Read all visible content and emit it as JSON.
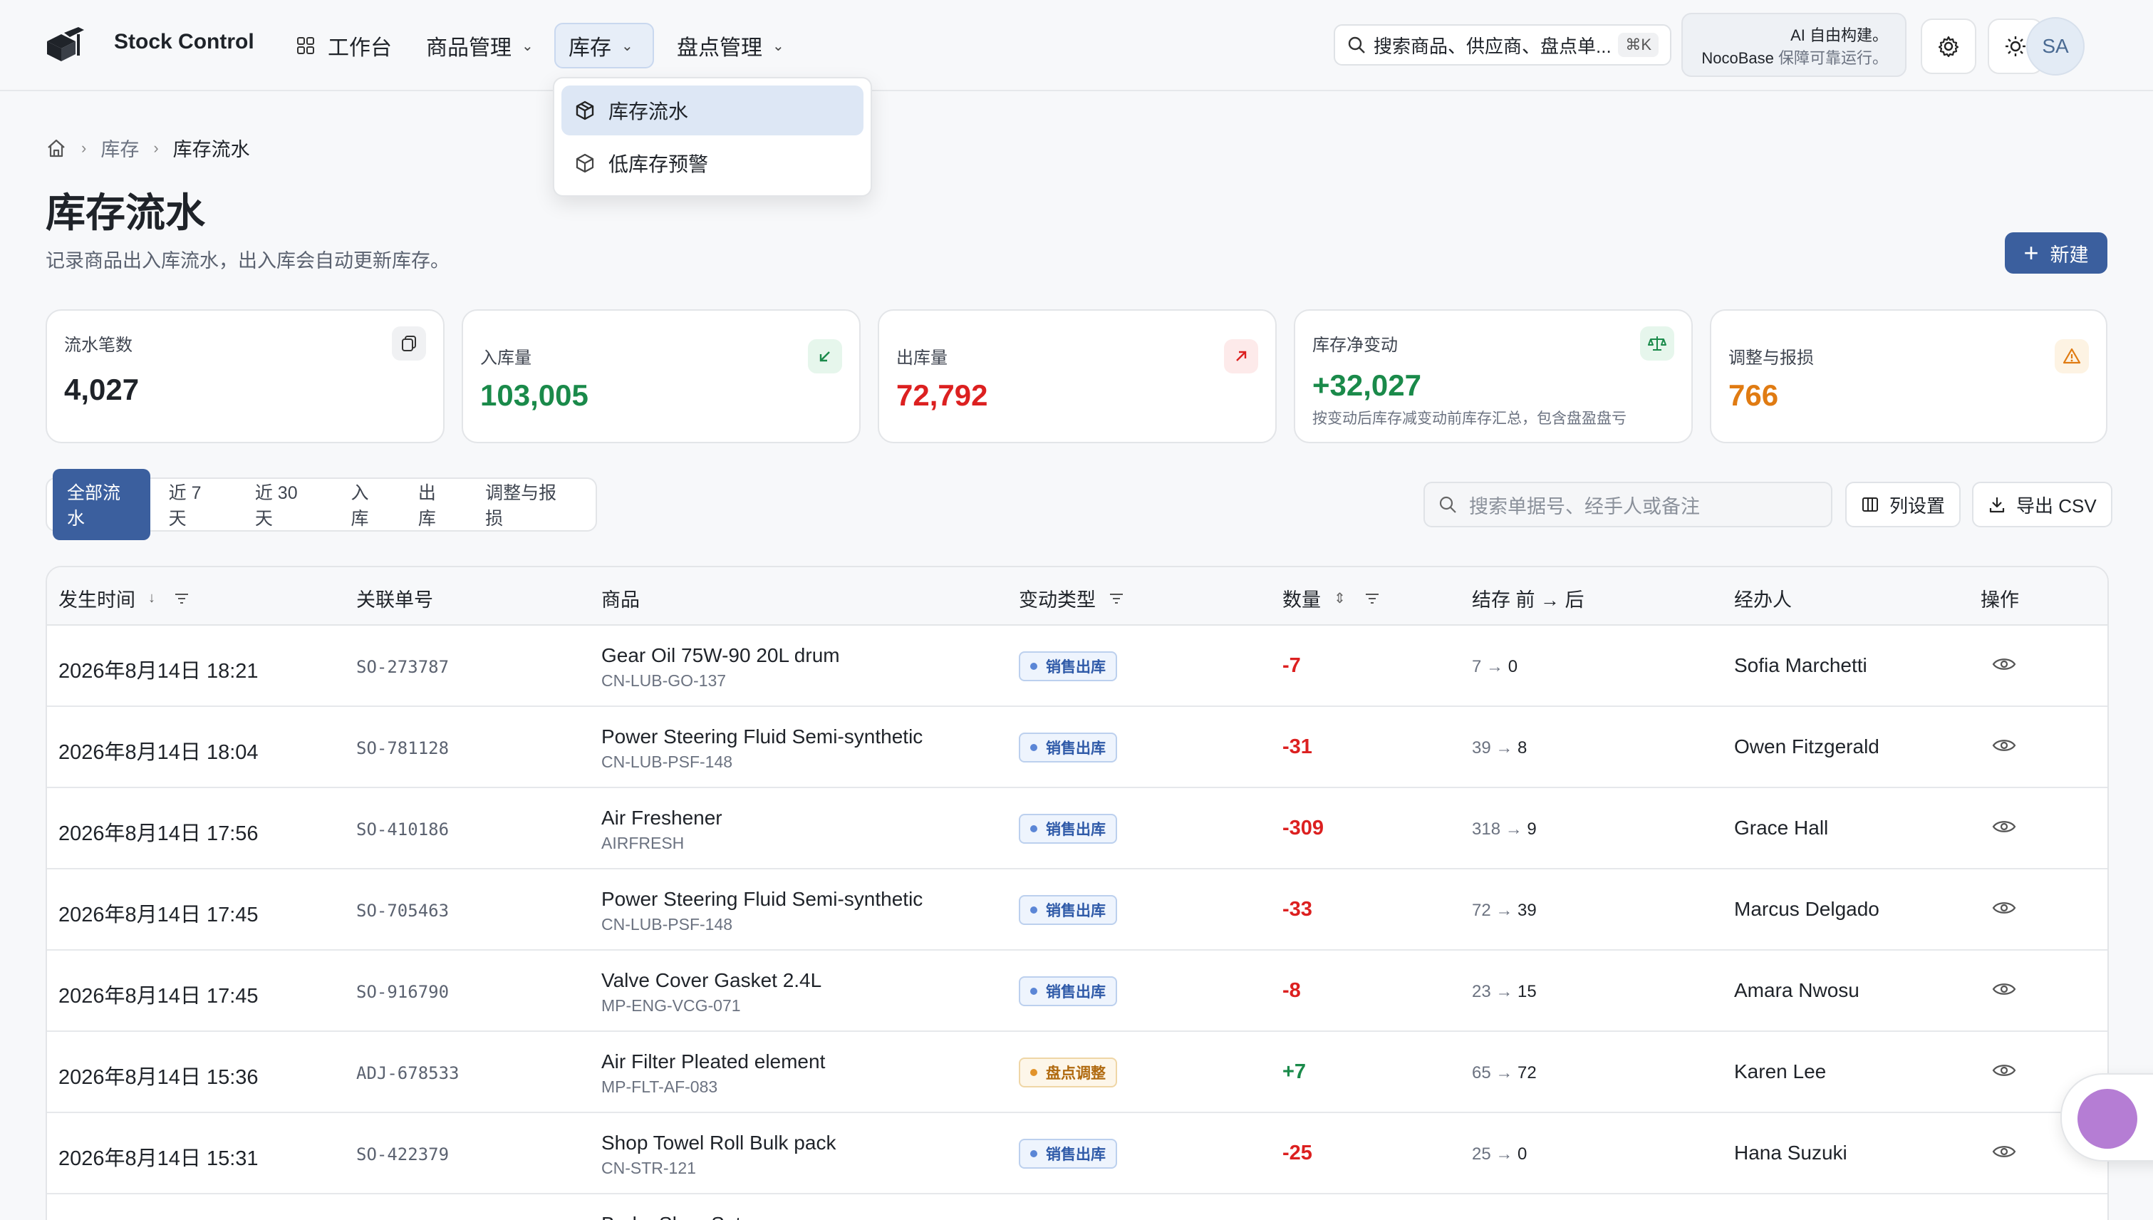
{
  "app": {
    "brand": "Stock Control"
  },
  "nav": {
    "items": [
      {
        "label": "工作台"
      },
      {
        "label": "商品管理"
      },
      {
        "label": "库存"
      },
      {
        "label": "盘点管理"
      }
    ]
  },
  "topbar": {
    "search_placeholder": "搜索商品、供应商、盘点单...",
    "search_shortcut": "⌘K",
    "ai_line1": "AI 自由构建。",
    "ai_brand": "NocoBase",
    "ai_line2": "保障可靠运行。",
    "avatar_initials": "SA"
  },
  "dropdown": {
    "items": [
      {
        "label": "库存流水",
        "icon": "box-icon",
        "selected": true
      },
      {
        "label": "低库存预警",
        "icon": "box-outline-icon",
        "selected": false
      }
    ]
  },
  "breadcrumb": {
    "parent": "库存",
    "current": "库存流水"
  },
  "page": {
    "title": "库存流水",
    "description": "记录商品出入库流水，出入库会自动更新库存。",
    "new_button": "新建"
  },
  "stats": [
    {
      "label": "流水笔数",
      "value": "4,027",
      "color": "#1f2329",
      "icon": "copy-icon"
    },
    {
      "label": "入库量",
      "value": "103,005",
      "color": "#1a8a4a",
      "icon": "arrow-down-left-icon"
    },
    {
      "label": "出库量",
      "value": "72,792",
      "color": "#dc2020",
      "icon": "arrow-up-right-icon"
    },
    {
      "label": "库存净变动",
      "value": "+32,027",
      "color": "#1a8a4a",
      "icon": "scale-icon",
      "note": "按变动后库存减变动前库存汇总，包含盘盈盘亏"
    },
    {
      "label": "调整与报损",
      "value": "766",
      "color": "#e07b12",
      "icon": "warning-icon"
    }
  ],
  "filters": {
    "chips": [
      "全部流水",
      "近 7 天",
      "近 30 天",
      "入库",
      "出库",
      "调整与报损"
    ],
    "active": 0,
    "search_placeholder": "搜索单据号、经手人或备注",
    "columns_button": "列设置",
    "export_button": "导出 CSV"
  },
  "table": {
    "headers": {
      "time": "发生时间",
      "ref": "关联单号",
      "product": "商品",
      "type": "变动类型",
      "qty": "数量",
      "balance": "结存 前 → 后",
      "user": "经办人",
      "action": "操作"
    },
    "rows": [
      {
        "time": "2026年8月14日 18:21",
        "ref": "SO-273787",
        "name": "Gear Oil 75W-90 20L drum",
        "sku": "CN-LUB-GO-137",
        "type": "销售出库",
        "tone": "blue",
        "qty": "-7",
        "before": "7",
        "after": "0",
        "user": "Sofia Marchetti"
      },
      {
        "time": "2026年8月14日 18:04",
        "ref": "SO-781128",
        "name": "Power Steering Fluid Semi-synthetic",
        "sku": "CN-LUB-PSF-148",
        "type": "销售出库",
        "tone": "blue",
        "qty": "-31",
        "before": "39",
        "after": "8",
        "user": "Owen Fitzgerald"
      },
      {
        "time": "2026年8月14日 17:56",
        "ref": "SO-410186",
        "name": "Air Freshener",
        "sku": "AIRFRESH",
        "type": "销售出库",
        "tone": "blue",
        "qty": "-309",
        "before": "318",
        "after": "9",
        "user": "Grace Hall"
      },
      {
        "time": "2026年8月14日 17:45",
        "ref": "SO-705463",
        "name": "Power Steering Fluid Semi-synthetic",
        "sku": "CN-LUB-PSF-148",
        "type": "销售出库",
        "tone": "blue",
        "qty": "-33",
        "before": "72",
        "after": "39",
        "user": "Marcus Delgado"
      },
      {
        "time": "2026年8月14日 17:45",
        "ref": "SO-916790",
        "name": "Valve Cover Gasket 2.4L",
        "sku": "MP-ENG-VCG-071",
        "type": "销售出库",
        "tone": "blue",
        "qty": "-8",
        "before": "23",
        "after": "15",
        "user": "Amara Nwosu"
      },
      {
        "time": "2026年8月14日 15:36",
        "ref": "ADJ-678533",
        "name": "Air Filter Pleated element",
        "sku": "MP-FLT-AF-083",
        "type": "盘点调整",
        "tone": "orange",
        "qty": "+7",
        "before": "65",
        "after": "72",
        "user": "Karen Lee"
      },
      {
        "time": "2026年8月14日 15:31",
        "ref": "SO-422379",
        "name": "Shop Towel Roll Bulk pack",
        "sku": "CN-STR-121",
        "type": "销售出库",
        "tone": "blue",
        "qty": "-25",
        "before": "25",
        "after": "0",
        "user": "Hana Suzuki"
      },
      {
        "time": "",
        "ref": "",
        "name": "Brake Shoe Set",
        "sku": "",
        "type": "",
        "tone": "blue",
        "qty": "",
        "before": "",
        "after": "",
        "user": ""
      }
    ]
  }
}
